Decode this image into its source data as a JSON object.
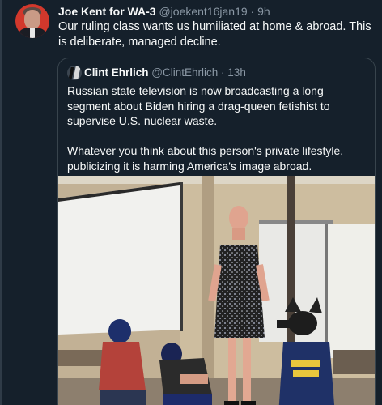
{
  "tweet": {
    "author_name": "Joe Kent for WA-3",
    "handle": "@joekent16jan19",
    "separator": "·",
    "time": "9h",
    "text": "Our ruling class wants us humiliated at home & abroad. This is deliberate, managed decline."
  },
  "quoted_tweet": {
    "author_name": "Clint Ehrlich",
    "handle": "@ClintEhrlich",
    "separator": "·",
    "time": "13h",
    "paragraphs": [
      "Russian state television is now broadcasting a long segment about Biden hiring a drag-queen fetishist to supervise U.S. nuclear waste.",
      "Whatever you think about this person's private lifestyle, publicizing it is harming America's image abroad."
    ],
    "shirt_text": "DAMN DADDY"
  },
  "colors": {
    "background": "#15202b",
    "text_primary": "#f7f9f9",
    "text_secondary": "#8b98a5",
    "card_border": "#38444d",
    "avatar_bg": "#d2382c"
  },
  "icons": {
    "author_avatar": "avatar-photo",
    "quoted_avatar": "avatar-photo"
  }
}
